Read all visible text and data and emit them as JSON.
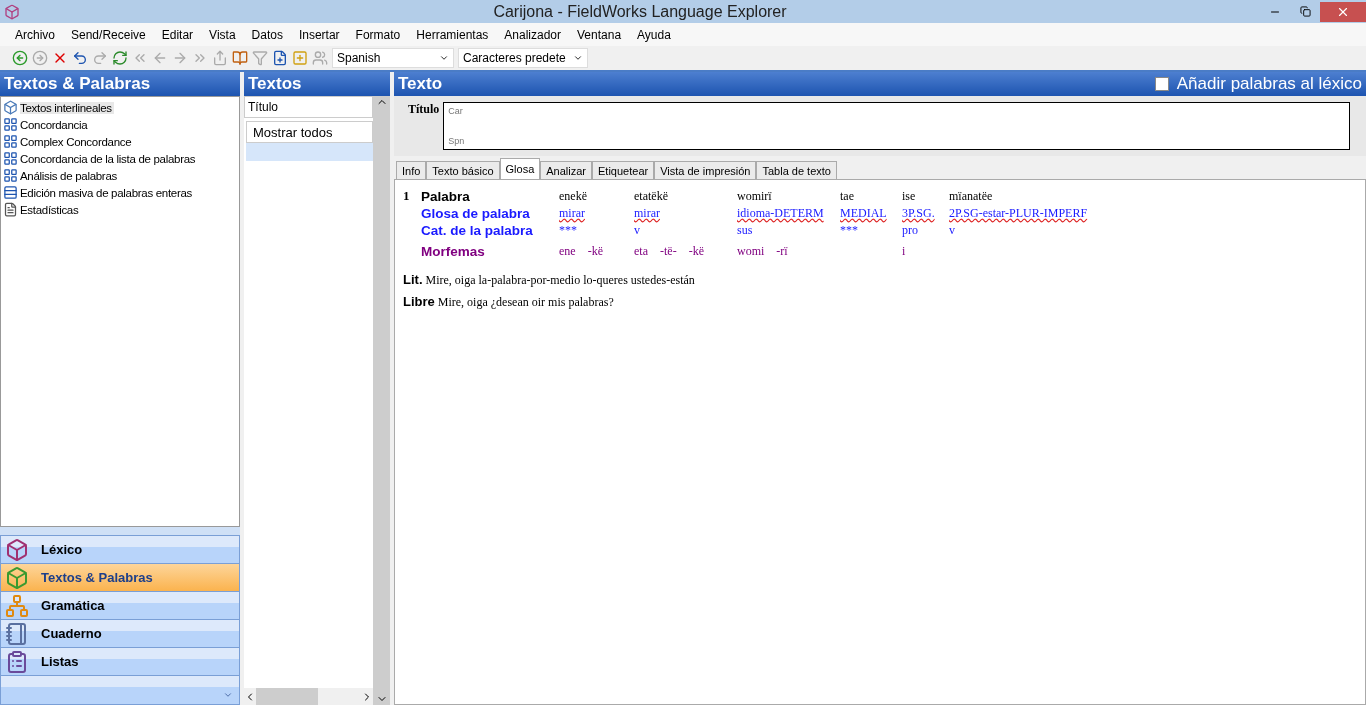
{
  "window": {
    "title": "Carijona - FieldWorks Language Explorer"
  },
  "menu": [
    "Archivo",
    "Send/Receive",
    "Editar",
    "Vista",
    "Datos",
    "Insertar",
    "Formato",
    "Herramientas",
    "Analizador",
    "Ventana",
    "Ayuda"
  ],
  "toolbar": {
    "writing_system": "Spanish",
    "style": "Caracteres predete"
  },
  "left_pane": {
    "title": "Textos & Palabras",
    "items": [
      {
        "label": "Textos interlineales",
        "selected": true,
        "kind": "cube"
      },
      {
        "label": "Concordancia",
        "selected": false,
        "kind": "grid"
      },
      {
        "label": "Complex Concordance",
        "selected": false,
        "kind": "grid"
      },
      {
        "label": "Concordancia de la lista de palabras",
        "selected": false,
        "kind": "grid"
      },
      {
        "label": "Análisis de palabras",
        "selected": false,
        "kind": "grid"
      },
      {
        "label": "Edición masiva de palabras enteras",
        "selected": false,
        "kind": "bulk"
      },
      {
        "label": "Estadísticas",
        "selected": false,
        "kind": "doc"
      }
    ],
    "areas": [
      {
        "label": "Léxico",
        "selected": false,
        "kind": "lexicon"
      },
      {
        "label": "Textos & Palabras",
        "selected": true,
        "kind": "texts"
      },
      {
        "label": "Gramática",
        "selected": false,
        "kind": "grammar"
      },
      {
        "label": "Cuaderno",
        "selected": false,
        "kind": "notebook"
      },
      {
        "label": "Listas",
        "selected": false,
        "kind": "lists"
      }
    ]
  },
  "middle_pane": {
    "title": "Textos",
    "column": "Título",
    "filter": "Mostrar todos"
  },
  "right_pane": {
    "title": "Texto",
    "add_words": {
      "label": "Añadir palabras al léxico",
      "checked": false
    },
    "title_label": "Título",
    "title_fields": [
      "Car",
      "Spn"
    ],
    "tabs": [
      {
        "label": "Info",
        "selected": false
      },
      {
        "label": "Texto básico",
        "selected": false
      },
      {
        "label": "Glosa",
        "selected": true
      },
      {
        "label": "Analizar",
        "selected": false
      },
      {
        "label": "Etiquetear",
        "selected": false
      },
      {
        "label": "Vista de impresión",
        "selected": false
      },
      {
        "label": "Tabla de texto",
        "selected": false
      }
    ],
    "segment": {
      "number": "1",
      "labels": [
        "Palabra",
        "Glosa de palabra",
        "Cat. de la palabra",
        "Morfemas"
      ],
      "words": [
        {
          "word": "enekë",
          "gloss": "mirar",
          "cat": "***",
          "morphemes": [
            "ene",
            "-kë"
          ]
        },
        {
          "word": "etatëkë",
          "gloss": "mirar",
          "cat": "v",
          "morphemes": [
            "eta",
            "-të-",
            "-kë"
          ]
        },
        {
          "word": "womirï",
          "gloss": "idioma-DETERM",
          "cat": "sus",
          "morphemes": [
            "womi",
            "-rï"
          ]
        },
        {
          "word": "tae",
          "gloss": "MEDIAL",
          "cat": "***"
        },
        {
          "word": "ise",
          "gloss": "3P.SG.",
          "cat": "pro",
          "morphemes": [
            "i"
          ]
        },
        {
          "word": "mïanatëe",
          "gloss": "2P.SG-estar-PLUR-IMPERF",
          "cat": "v"
        }
      ],
      "free_lines": [
        {
          "label": "Lit.",
          "text": "Mire, oiga la-palabra-por-medio lo-queres ustedes-están"
        },
        {
          "label": "Libre",
          "text": "Mire, oiga ¿desean oir mis palabras?"
        }
      ]
    }
  }
}
